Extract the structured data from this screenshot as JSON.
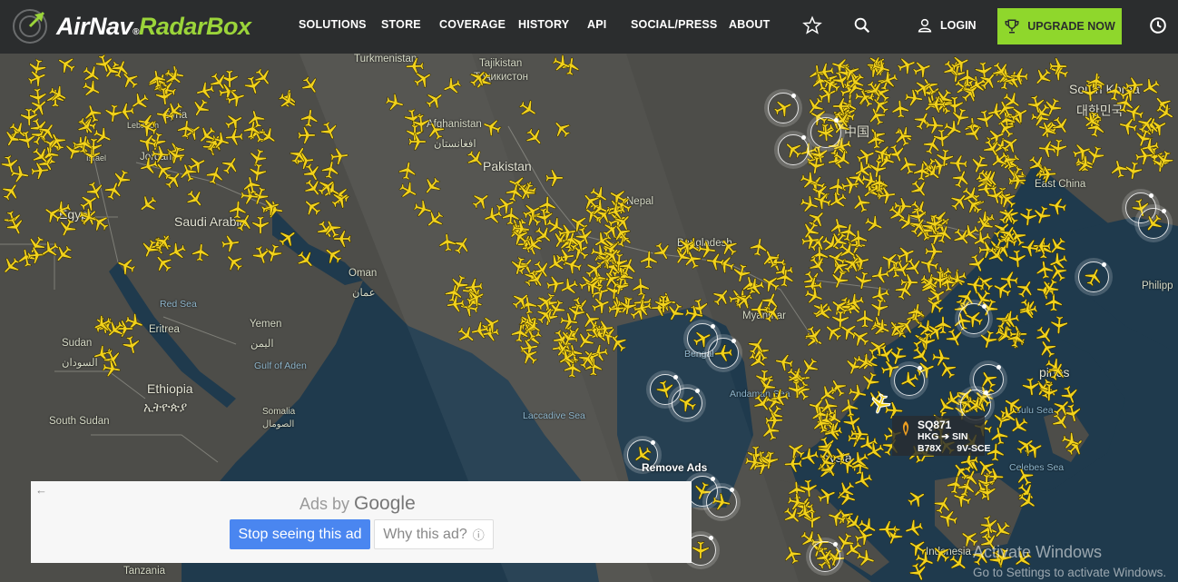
{
  "brand": {
    "name_part1": "AirNav",
    "name_part2": "RadarBox",
    "registered_mark": "®"
  },
  "nav": {
    "items": [
      "SOLUTIONS",
      "STORE",
      "COVERAGE",
      "HISTORY",
      "API",
      "SOCIAL/PRESS",
      "ABOUT"
    ],
    "login_label": "LOGIN",
    "upgrade_label": "UPGRADE NOW",
    "icons": [
      "star-icon",
      "search-icon",
      "user-icon",
      "trophy-icon",
      "clock-icon"
    ]
  },
  "colors": {
    "navbar": "#2b2d2e",
    "accent_green": "#8fd72c",
    "plane_yellow": "#f2d21c",
    "land": "#4c4c48",
    "sea": "#1f3a4d"
  },
  "map": {
    "labels": {
      "turkmenistan": "Turkmenistan",
      "tajikistan": "Tajikistan",
      "tajikistan_native": "Тоҷикистон",
      "afghanistan": "Afghanistan",
      "afghanistan_native": "افغانستان",
      "pakistan": "Pakistan",
      "syria": "Syria",
      "lebanon": "Lebanon",
      "israel": "Israel",
      "jordan": "Jordan",
      "egypt": "Egypt",
      "saudi_arabia": "Saudi Arabia",
      "oman": "Oman",
      "oman_native": "عمان",
      "yemen": "Yemen",
      "yemen_native": "اليمن",
      "red_sea": "Red Sea",
      "eritrea": "Eritrea",
      "sudan": "Sudan",
      "sudan_native": "السودان",
      "ethiopia": "Ethiopia",
      "ethiopia_native": "ኢትዮጵያ",
      "south_sudan": "South Sudan",
      "somalia": "Somalia",
      "somalia_native": "الصومال",
      "gulf_of_aden": "Gulf of Aden",
      "tanzania": "Tanzania",
      "nepal": "Nepal",
      "bangladesh": "Bangladesh",
      "myanmar": "Myanmar",
      "laccadive_sea": "Laccadive Sea",
      "andaman_sea": "Andaman Sea",
      "bengal": "Bengal",
      "china_native": "中国",
      "east_china": "East China",
      "south_korea": "South Korea",
      "korea_native": "대한민국",
      "philippines": "Philipp",
      "pines": "pines",
      "sulu_sea": "Sulu Sea",
      "celebes_sea": "Celebes Sea",
      "malaysia": "aysia",
      "indonesia": "Indonesia"
    }
  },
  "flight": {
    "callsign": "SQ871",
    "origin": "HKG",
    "destination": "SIN",
    "aircraft": "B78X",
    "registration": "9V-SCE"
  },
  "remove_ads": "Remove Ads",
  "ad": {
    "ads_by": "Ads by",
    "google": "Google",
    "stop_label": "Stop seeing this ad",
    "why_label": "Why this ad?",
    "back_arrow": "←",
    "info_icon": "ⓘ"
  },
  "windows": {
    "title": "Activate Windows",
    "subtitle": "Go to Settings to activate Windows."
  }
}
